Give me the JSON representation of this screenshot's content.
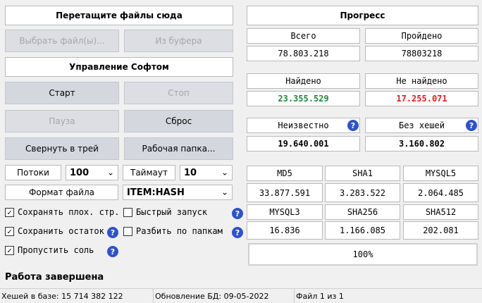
{
  "left": {
    "drop_zone": "Перетащите файлы сюда",
    "select_files": "Выбрать файл(ы)...",
    "from_clipboard": "Из буфера",
    "control_header": "Управление Софтом",
    "start": "Старт",
    "stop": "Стоп",
    "pause": "Пауза",
    "reset": "Сброс",
    "minimize_tray": "Свернуть в трей",
    "work_folder": "Рабочая папка...",
    "threads_label": "Потоки",
    "threads_value": "100",
    "timeout_label": "Таймаут",
    "timeout_value": "10",
    "file_format_label": "Формат файла",
    "file_format_value": "ITEM:HASH",
    "options": {
      "save_bad": "Сохранять плох. стр.",
      "fast_start": "Быстрый запуск",
      "save_rest": "Сохранить остаток",
      "split_folders": "Разбить по папкам",
      "skip_salt": "Пропустить соль"
    },
    "status_text": "Работа завершена"
  },
  "right": {
    "progress_header": "Прогресс",
    "total_label": "Всего",
    "total_value": "78.803.218",
    "passed_label": "Пройдено",
    "passed_value": "78803218",
    "found_label": "Найдено",
    "found_value": "23.355.529",
    "not_found_label": "Не найдено",
    "not_found_value": "17.255.071",
    "unknown_label": "Неизвестно",
    "unknown_value": "19.640.001",
    "no_hash_label": "Без хешей",
    "no_hash_value": "3.160.802",
    "hashes": [
      {
        "name": "MD5",
        "value": "33.877.591"
      },
      {
        "name": "SHA1",
        "value": "3.283.522"
      },
      {
        "name": "MYSQL5",
        "value": "2.064.485"
      },
      {
        "name": "MYSQL3",
        "value": "16.836"
      },
      {
        "name": "SHA256",
        "value": "1.166.085"
      },
      {
        "name": "SHA512",
        "value": "202.081"
      }
    ],
    "progress_percent": "100%",
    "progress_fraction": 1.0
  },
  "statusbar": {
    "hashes_in_db": "Хешей в базе: 15 714 382 122",
    "db_update": "Обновление БД: 09-05-2022",
    "file_counter": "Файл 1 из 1"
  },
  "colors": {
    "found": "#1f8a3c",
    "not_found": "#e01b1b",
    "help": "#2f52c8"
  },
  "icons": {
    "help": "question-mark-circle",
    "dropdown": "chevron-down",
    "checkbox": "checkmark"
  },
  "checkbox_states": {
    "save_bad": true,
    "fast_start": false,
    "save_rest": true,
    "split_folders": false,
    "skip_salt": true
  }
}
